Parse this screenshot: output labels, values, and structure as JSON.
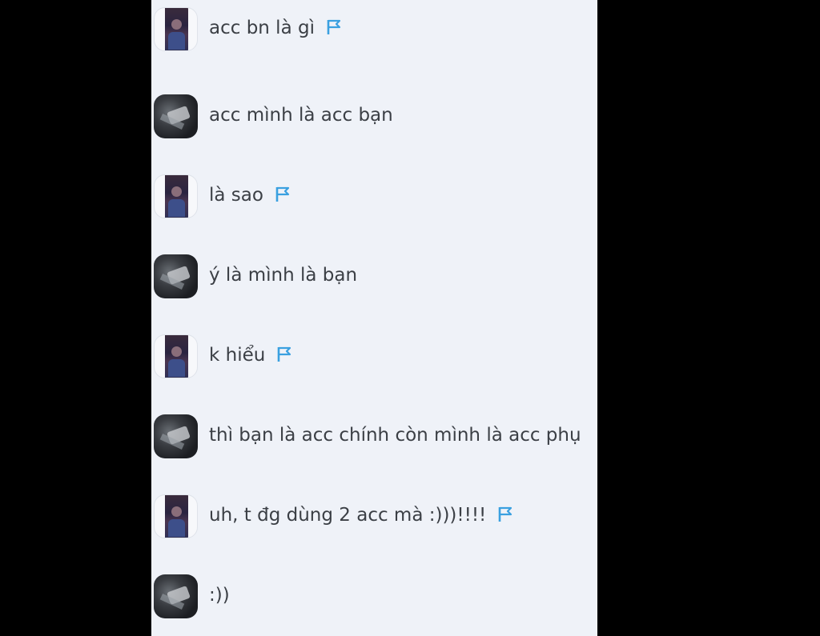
{
  "chat": {
    "messages": [
      {
        "sender": "user-a",
        "text": "acc bn là gì",
        "flag": true
      },
      {
        "sender": "user-b",
        "text": "acc mình là acc bạn",
        "flag": false
      },
      {
        "sender": "user-a",
        "text": "là sao",
        "flag": true
      },
      {
        "sender": "user-b",
        "text": "ý là mình là bạn",
        "flag": false
      },
      {
        "sender": "user-a",
        "text": "k hiểu",
        "flag": true
      },
      {
        "sender": "user-b",
        "text": "thì bạn là acc chính còn mình là acc phụ",
        "flag": false
      },
      {
        "sender": "user-a",
        "text": "uh, t đg dùng 2 acc mà :)))!!!!",
        "flag": true
      },
      {
        "sender": "user-b",
        "text": ":))",
        "flag": false
      }
    ]
  },
  "colors": {
    "background": "#000000",
    "panel": "#eff2f8",
    "text": "#3b3f45",
    "flag": "#3aa0e0"
  },
  "icons": {
    "flag": "flag-icon",
    "avatar": "avatar"
  }
}
